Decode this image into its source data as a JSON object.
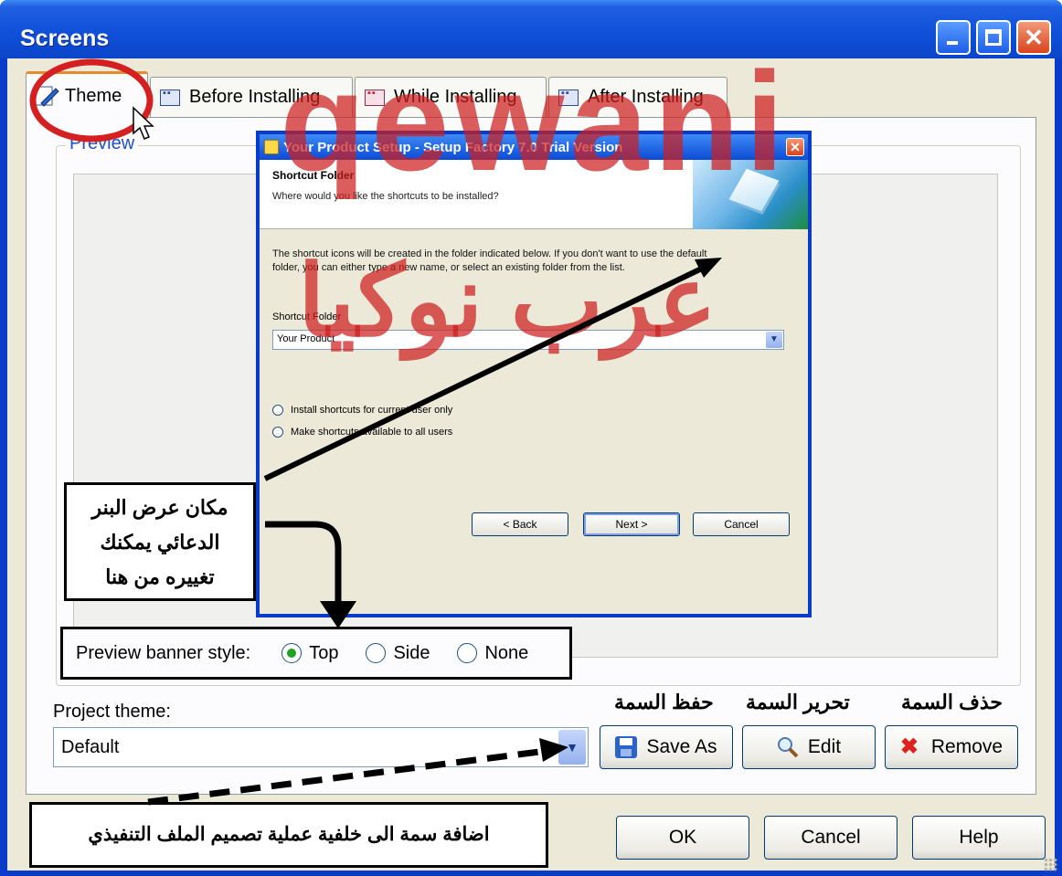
{
  "window": {
    "title": "Screens"
  },
  "tabs": [
    {
      "label": "Theme"
    },
    {
      "label": "Before Installing"
    },
    {
      "label": "While Installing"
    },
    {
      "label": "After Installing"
    }
  ],
  "preview": {
    "group_label": "Preview",
    "setup_dialog": {
      "title": "Your Product Setup - Setup Factory 7.0 Trial Version",
      "header_title": "Shortcut Folder",
      "header_subtitle": "Where would you like the shortcuts to be installed?",
      "body_line1": "The shortcut icons will be created in the folder indicated below. If you don't want to use the default",
      "body_line2": "folder, you can either type a new name, or select an existing folder from the list.",
      "folder_label": "Shortcut Folder",
      "folder_value": "Your Product",
      "radio_current_user": "Install shortcuts for current user only",
      "radio_all_users": "Make shortcuts available to all users",
      "back": "< Back",
      "next": "Next >",
      "cancel": "Cancel"
    }
  },
  "banner_style": {
    "label": "Preview banner style:",
    "options": [
      "Top",
      "Side",
      "None"
    ],
    "selected": "Top"
  },
  "project_theme": {
    "label": "Project theme:",
    "value": "Default"
  },
  "buttons": {
    "save_as": "Save As",
    "edit": "Edit",
    "remove": "Remove",
    "ok": "OK",
    "cancel": "Cancel",
    "help": "Help"
  },
  "watermark": {
    "latin": "qewani",
    "arabic": "عرب نوكيا"
  },
  "annotations": {
    "banner_place": [
      "مكان عرض البنر",
      "الدعائي يمكنك",
      "تغييره من هنا"
    ],
    "save_theme": "حفظ السمة",
    "edit_theme": "تحرير السمة",
    "delete_theme": "حذف السمة",
    "add_theme": "اضافة سمة الى خلفية عملية تصميم الملف التنفيذي"
  },
  "colors": {
    "titlebar": "#0f4fd8",
    "accent_tab": "#e68b2c",
    "annotation_red": "#d42020",
    "watermark": "#cd1e1e"
  }
}
